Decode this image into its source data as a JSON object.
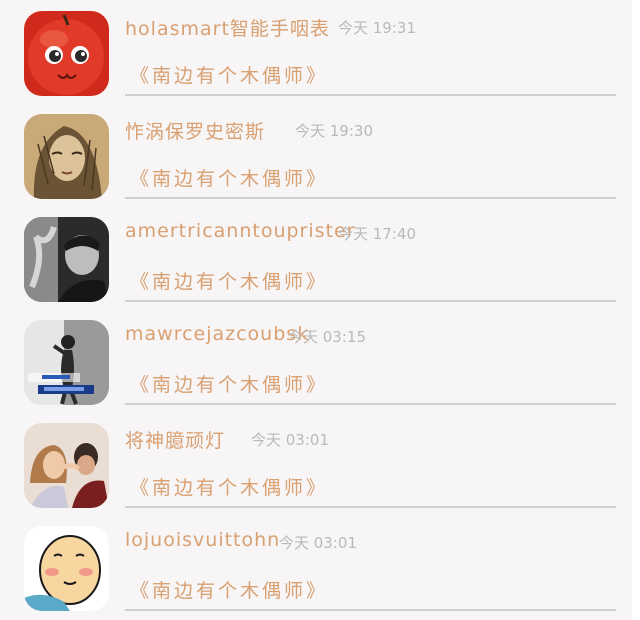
{
  "messages": [
    {
      "sender": "holasmart智能手咽表",
      "time": "今天 19:31",
      "title": "《南边有个木偶师》",
      "avatar_icon": "red-apple-face-avatar"
    },
    {
      "sender": "怍涡保罗史密斯",
      "time": "今天 19:30",
      "title": "《南边有个木偶师》",
      "avatar_icon": "sketch-girl-avatar"
    },
    {
      "sender": "amertricanntouprister",
      "time": "今天 17:40",
      "title": "《南边有个木偶师》",
      "avatar_icon": "bw-man-smoke-avatar"
    },
    {
      "sender": "mawrcejazcoubsk",
      "time": "今天 03:15",
      "title": "《南边有个木偶师》",
      "avatar_icon": "bw-person-leaning-avatar"
    },
    {
      "sender": "将神臆顽灯",
      "time": "今天 03:01",
      "title": "《南边有个木偶师》",
      "avatar_icon": "couple-photo-avatar"
    },
    {
      "sender": "lojuoisvuittohn",
      "time": "今天 03:01",
      "title": "《南边有个木偶师》",
      "avatar_icon": "cartoon-bald-man-avatar"
    }
  ],
  "colors": {
    "accent": "#d9a071",
    "muted": "#b9b9b9",
    "divider": "#cfcfcf",
    "background": "#f7f5f6"
  }
}
